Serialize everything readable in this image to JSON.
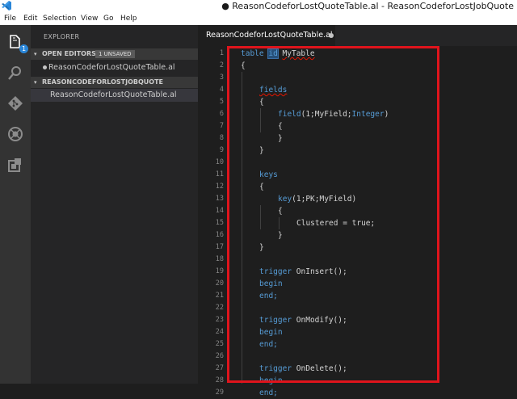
{
  "titlebar": {
    "title": "● ReasonCodeforLostQuoteTable.al - ReasonCodeforLostJobQuote"
  },
  "menu": [
    "File",
    "Edit",
    "Selection",
    "View",
    "Go",
    "Help"
  ],
  "activity_icons": [
    "explorer-icon",
    "search-icon",
    "git-icon",
    "debug-icon",
    "extensions-icon"
  ],
  "explorer_badge": "1",
  "sidebar": {
    "title": "EXPLORER",
    "open_editors": {
      "label": "OPEN EDITORS",
      "badge": "1 UNSAVED",
      "files": [
        "ReasonCodeforLostQuoteTable.al"
      ]
    },
    "project": {
      "label": "REASONCODEFORLOSTJOBQUOTE",
      "files": [
        "ReasonCodeforLostQuoteTable.al"
      ]
    }
  },
  "tab": {
    "label": "ReasonCodeforLostQuoteTable.al"
  },
  "editor": {
    "line_numbers": [
      "1",
      "2",
      "3",
      "4",
      "5",
      "6",
      "7",
      "8",
      "9",
      "10",
      "11",
      "12",
      "13",
      "14",
      "15",
      "16",
      "17",
      "18",
      "19",
      "20",
      "21",
      "22",
      "23",
      "24",
      "25",
      "26",
      "27",
      "28",
      "29"
    ],
    "code": {
      "l1_kw": "table",
      "l1_id": "id",
      "l1_name": "MyTable",
      "l2": "{",
      "l4": "fields",
      "l5": "{",
      "l6_kw": "field",
      "l6_rest": "(1;MyField;",
      "l6_type": "Integer",
      "l6_end": ")",
      "l7": "{",
      "l8": "}",
      "l9": "}",
      "l11": "keys",
      "l12": "{",
      "l13_kw": "key",
      "l13_rest": "(1;PK;MyField)",
      "l14": "{",
      "l15": "Clustered = true;",
      "l16": "}",
      "l17": "}",
      "l19_kw": "trigger",
      "l19_name": "OnInsert();",
      "l20": "begin",
      "l21": "end;",
      "l23_kw": "trigger",
      "l23_name": "OnModify();",
      "l24": "begin",
      "l25": "end;",
      "l27_kw": "trigger",
      "l27_name": "OnDelete();",
      "l28": "begin",
      "l29": "end;"
    }
  }
}
